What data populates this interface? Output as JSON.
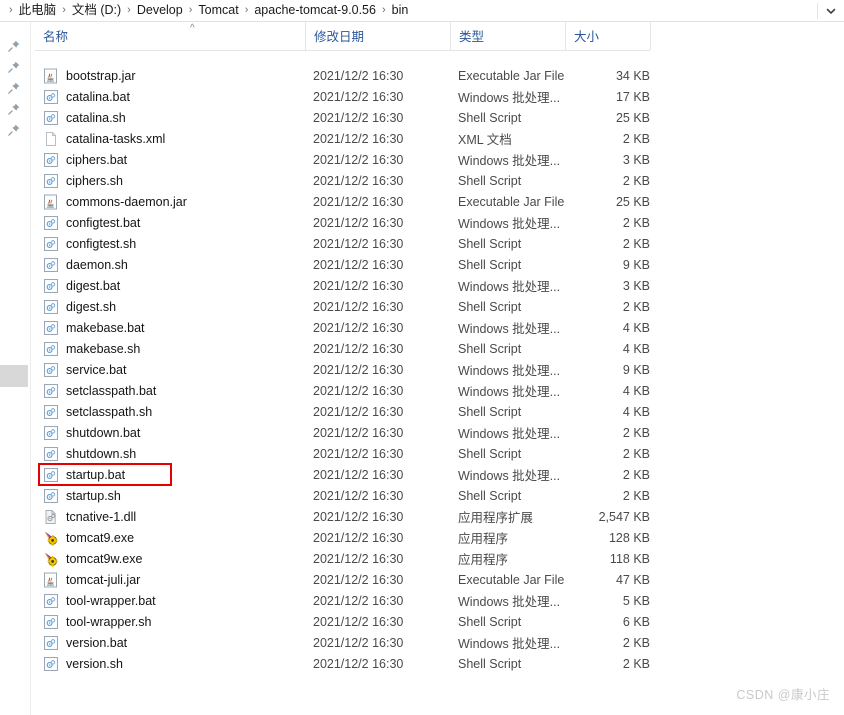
{
  "address_bar": {
    "separator": "›",
    "crumbs": [
      "此电脑",
      "文档 (D:)",
      "Develop",
      "Tomcat",
      "apache-tomcat-9.0.56",
      "bin"
    ],
    "dropdown_icon": "chevron-down-icon"
  },
  "columns": {
    "name": "名称",
    "date": "修改日期",
    "type": "类型",
    "size": "大小",
    "sort_caret": "^"
  },
  "nav_pane": {
    "pin_icon": "pin-icon",
    "pin_count": 5
  },
  "highlight": {
    "target": "startup.bat",
    "color": "#e60000"
  },
  "watermark": "CSDN @康小庄",
  "files": [
    {
      "name": "bootstrap.jar",
      "icon": "jar-icon",
      "date": "2021/12/2 16:30",
      "type": "Executable Jar File",
      "size": "34 KB"
    },
    {
      "name": "catalina.bat",
      "icon": "script-icon",
      "date": "2021/12/2 16:30",
      "type": "Windows 批处理...",
      "size": "17 KB"
    },
    {
      "name": "catalina.sh",
      "icon": "script-icon",
      "date": "2021/12/2 16:30",
      "type": "Shell Script",
      "size": "25 KB"
    },
    {
      "name": "catalina-tasks.xml",
      "icon": "xml-icon",
      "date": "2021/12/2 16:30",
      "type": "XML 文档",
      "size": "2 KB"
    },
    {
      "name": "ciphers.bat",
      "icon": "script-icon",
      "date": "2021/12/2 16:30",
      "type": "Windows 批处理...",
      "size": "3 KB"
    },
    {
      "name": "ciphers.sh",
      "icon": "script-icon",
      "date": "2021/12/2 16:30",
      "type": "Shell Script",
      "size": "2 KB"
    },
    {
      "name": "commons-daemon.jar",
      "icon": "jar-icon",
      "date": "2021/12/2 16:30",
      "type": "Executable Jar File",
      "size": "25 KB"
    },
    {
      "name": "configtest.bat",
      "icon": "script-icon",
      "date": "2021/12/2 16:30",
      "type": "Windows 批处理...",
      "size": "2 KB"
    },
    {
      "name": "configtest.sh",
      "icon": "script-icon",
      "date": "2021/12/2 16:30",
      "type": "Shell Script",
      "size": "2 KB"
    },
    {
      "name": "daemon.sh",
      "icon": "script-icon",
      "date": "2021/12/2 16:30",
      "type": "Shell Script",
      "size": "9 KB"
    },
    {
      "name": "digest.bat",
      "icon": "script-icon",
      "date": "2021/12/2 16:30",
      "type": "Windows 批处理...",
      "size": "3 KB"
    },
    {
      "name": "digest.sh",
      "icon": "script-icon",
      "date": "2021/12/2 16:30",
      "type": "Shell Script",
      "size": "2 KB"
    },
    {
      "name": "makebase.bat",
      "icon": "script-icon",
      "date": "2021/12/2 16:30",
      "type": "Windows 批处理...",
      "size": "4 KB"
    },
    {
      "name": "makebase.sh",
      "icon": "script-icon",
      "date": "2021/12/2 16:30",
      "type": "Shell Script",
      "size": "4 KB"
    },
    {
      "name": "service.bat",
      "icon": "script-icon",
      "date": "2021/12/2 16:30",
      "type": "Windows 批处理...",
      "size": "9 KB"
    },
    {
      "name": "setclasspath.bat",
      "icon": "script-icon",
      "date": "2021/12/2 16:30",
      "type": "Windows 批处理...",
      "size": "4 KB"
    },
    {
      "name": "setclasspath.sh",
      "icon": "script-icon",
      "date": "2021/12/2 16:30",
      "type": "Shell Script",
      "size": "4 KB"
    },
    {
      "name": "shutdown.bat",
      "icon": "script-icon",
      "date": "2021/12/2 16:30",
      "type": "Windows 批处理...",
      "size": "2 KB"
    },
    {
      "name": "shutdown.sh",
      "icon": "script-icon",
      "date": "2021/12/2 16:30",
      "type": "Shell Script",
      "size": "2 KB"
    },
    {
      "name": "startup.bat",
      "icon": "script-icon",
      "date": "2021/12/2 16:30",
      "type": "Windows 批处理...",
      "size": "2 KB"
    },
    {
      "name": "startup.sh",
      "icon": "script-icon",
      "date": "2021/12/2 16:30",
      "type": "Shell Script",
      "size": "2 KB"
    },
    {
      "name": "tcnative-1.dll",
      "icon": "dll-icon",
      "date": "2021/12/2 16:30",
      "type": "应用程序扩展",
      "size": "2,547 KB"
    },
    {
      "name": "tomcat9.exe",
      "icon": "tomcat-icon",
      "date": "2021/12/2 16:30",
      "type": "应用程序",
      "size": "128 KB"
    },
    {
      "name": "tomcat9w.exe",
      "icon": "tomcat-icon",
      "date": "2021/12/2 16:30",
      "type": "应用程序",
      "size": "118 KB"
    },
    {
      "name": "tomcat-juli.jar",
      "icon": "jar-icon",
      "date": "2021/12/2 16:30",
      "type": "Executable Jar File",
      "size": "47 KB"
    },
    {
      "name": "tool-wrapper.bat",
      "icon": "script-icon",
      "date": "2021/12/2 16:30",
      "type": "Windows 批处理...",
      "size": "5 KB"
    },
    {
      "name": "tool-wrapper.sh",
      "icon": "script-icon",
      "date": "2021/12/2 16:30",
      "type": "Shell Script",
      "size": "6 KB"
    },
    {
      "name": "version.bat",
      "icon": "script-icon",
      "date": "2021/12/2 16:30",
      "type": "Windows 批处理...",
      "size": "2 KB"
    },
    {
      "name": "version.sh",
      "icon": "script-icon",
      "date": "2021/12/2 16:30",
      "type": "Shell Script",
      "size": "2 KB"
    }
  ]
}
